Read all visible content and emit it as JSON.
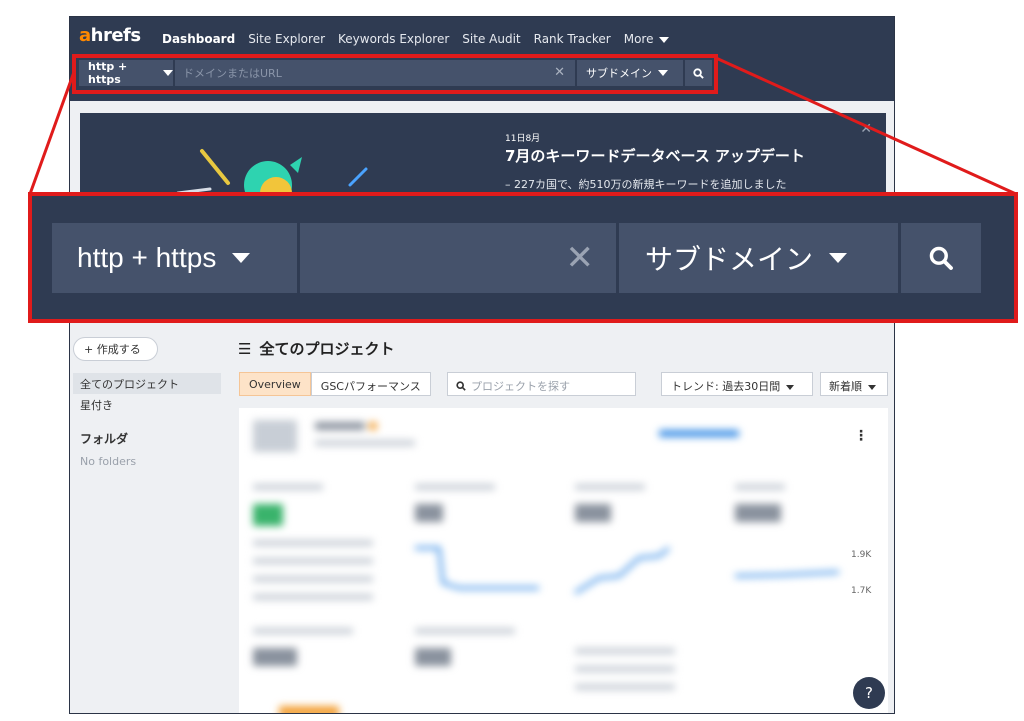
{
  "nav": {
    "logo_a": "a",
    "logo_rest": "hrefs",
    "links": [
      "Dashboard",
      "Site Explorer",
      "Keywords Explorer",
      "Site Audit",
      "Rank Tracker",
      "More"
    ]
  },
  "search": {
    "protocol": "http + https",
    "placeholder": "ドメインまたはURL",
    "clear_symbol": "✕",
    "mode": "サブドメイン"
  },
  "banner": {
    "close_symbol": "✕",
    "date": "11日8月",
    "title": "7月のキーワードデータベース アップデート",
    "description": "– 227カ国で、約510万の新規キーワードを追加しました"
  },
  "sidebar": {
    "create_label": "+ 作成する",
    "all_projects": "全てのプロジェクト",
    "starred": "星付き",
    "folders_title": "フォルダ",
    "no_folders": "No folders"
  },
  "projects": {
    "title": "全てのプロジェクト",
    "tabs": [
      "Overview",
      "GSCパフォーマンス"
    ],
    "search_placeholder": "プロジェクトを探す",
    "trend_label": "トレンド: 過去30日間",
    "sort_label": "新着順",
    "axis_top": "1.9K",
    "axis_bottom": "1.7K",
    "help_label": "?"
  },
  "colors": {
    "nav_bg": "#2f3b52",
    "segment_bg": "#45526b",
    "brand_orange": "#ff8800",
    "callout_red": "#e01b1b",
    "active_tab": "#fde3c8"
  },
  "icons": [
    "search-icon",
    "close-icon",
    "chevron-down-icon",
    "menu-icon",
    "kebab-icon",
    "help-icon"
  ]
}
